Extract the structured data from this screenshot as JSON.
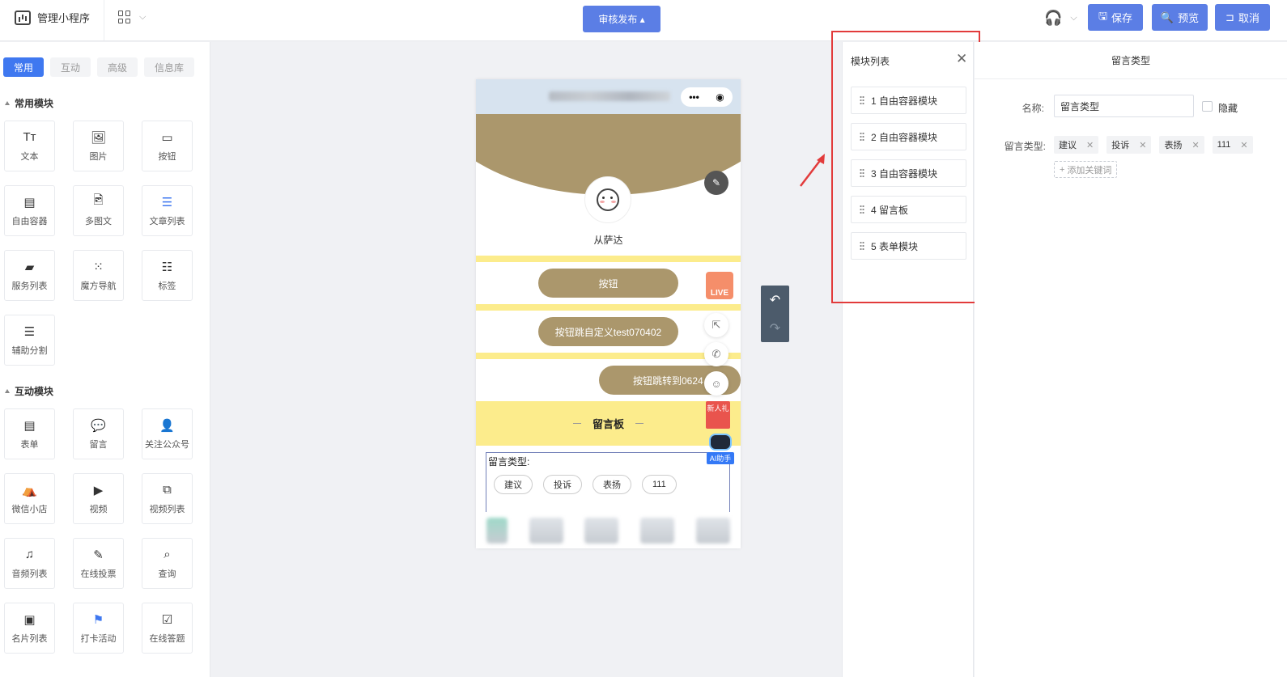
{
  "header": {
    "brand": "管理小程序",
    "publish_label": "审核发布 ▴",
    "save_label": "保存",
    "preview_label": "预览",
    "cancel_label": "取消"
  },
  "left": {
    "tabs": [
      "常用",
      "互动",
      "高级",
      "信息库"
    ],
    "section1_title": "常用模块",
    "common_modules": [
      "文本",
      "图片",
      "按钮",
      "自由容器",
      "多图文",
      "文章列表",
      "服务列表",
      "魔方导航",
      "标签",
      "辅助分割"
    ],
    "section2_title": "互动模块",
    "interactive_modules": [
      "表单",
      "留言",
      "关注公众号",
      "微信小店",
      "视频",
      "视频列表",
      "音频列表",
      "在线投票",
      "查询",
      "名片列表",
      "打卡活动",
      "在线答题"
    ]
  },
  "phone": {
    "username": "从萨达",
    "button1": "按钮",
    "button2": "按钮跳自定义test070402",
    "button3": "按钮跳转到0624",
    "msg_board_title": "留言板",
    "msg_type_label": "留言类型:",
    "chips": [
      "建议",
      "投诉",
      "表扬",
      "111"
    ],
    "live_badge": "LIVE",
    "gift_badge": "新人礼",
    "ai_badge": "AI助手"
  },
  "module_list": {
    "title": "模块列表",
    "items": [
      "1 自由容器模块",
      "2 自由容器模块",
      "3 自由容器模块",
      "4 留言板",
      "5 表单模块"
    ]
  },
  "props": {
    "title": "留言类型",
    "name_label": "名称:",
    "name_value": "留言类型",
    "hide_label": "隐藏",
    "type_label": "留言类型:",
    "tags": [
      "建议",
      "投诉",
      "表扬",
      "111"
    ],
    "add_keyword": "添加关键词"
  },
  "colors": {
    "accent": "#3f78f0",
    "button_blue": "#5b7ee5",
    "theme_brown": "#ab976c",
    "theme_yellow": "#fcec8c",
    "highlight_red": "#e23b3b"
  }
}
